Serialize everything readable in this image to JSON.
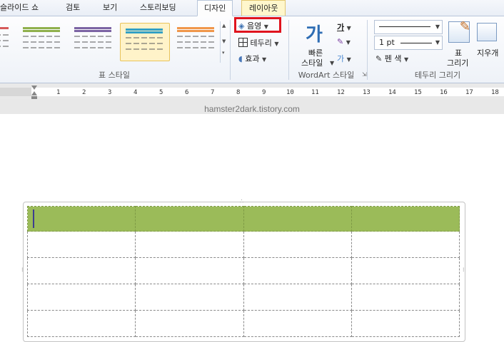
{
  "tabs": [
    {
      "label": "슬라이드 쇼"
    },
    {
      "label": "검토"
    },
    {
      "label": "보기"
    },
    {
      "label": "스토리보딩"
    },
    {
      "label": "디자인"
    },
    {
      "label": "레이아웃"
    }
  ],
  "ribbon": {
    "shading_label": "음영",
    "borders_label": "테두리",
    "effects_label": "효과",
    "table_styles_group": "표 스타일",
    "wordart_quick_label_1": "빠른",
    "wordart_quick_label_2": "스타일",
    "wordart_group": "WordArt 스타일",
    "pen_weight": "1 pt",
    "pen_color_label": "펜 색",
    "draw_table_label_1": "표",
    "draw_table_label_2": "그리기",
    "eraser_label": "지우개",
    "draw_borders_group": "테두리 그리기",
    "glyph_ga": "가"
  },
  "ruler": {
    "numbers": [
      "1",
      "2",
      "3",
      "4",
      "5",
      "6",
      "7",
      "8",
      "9",
      "10",
      "11",
      "12",
      "13",
      "14",
      "15",
      "16",
      "17",
      "18"
    ]
  },
  "watermark": "hamster2dark.tistory.com",
  "colors": {
    "header_fill": "#9bbb59",
    "highlight_box": "#e0141e",
    "selected_style_border": "#e8c35a"
  },
  "table": {
    "rows": 5,
    "cols": 4
  }
}
